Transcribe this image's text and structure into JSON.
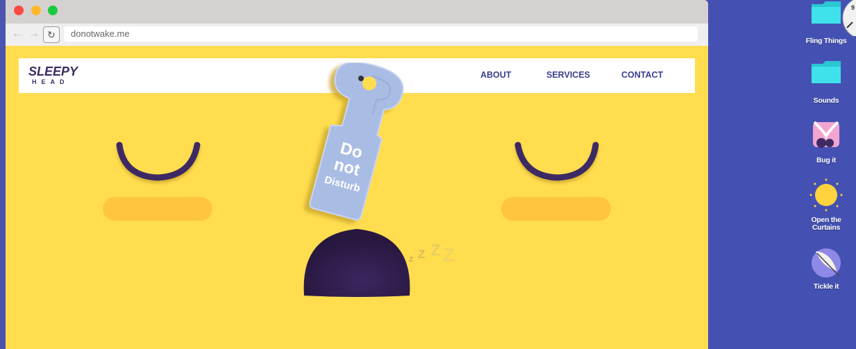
{
  "browser": {
    "url": "donotwake.me",
    "back_icon": "arrow-left-icon",
    "forward_icon": "arrow-right-icon",
    "reload_icon": "reload-icon"
  },
  "site": {
    "logo_top": "SLEEPY",
    "logo_bottom": "HEAD",
    "menu": [
      "ABOUT",
      "SERVICES",
      "CONTACT"
    ],
    "hanger_text": [
      "Do",
      "not",
      "Disturb"
    ],
    "zzz": [
      "z",
      "Z",
      "Z"
    ],
    "colors": {
      "background": "#ffdd4f",
      "cheek": "#ffc53f",
      "eyes": "#3d2a63",
      "mouth": "#2e1b4b",
      "hanger": "#a9bce4",
      "menu": "#3b3f8d"
    }
  },
  "desktop": {
    "background": "#4451b3",
    "items": [
      {
        "label": "Fling Things",
        "icon": "folder-icon"
      },
      {
        "label": "Sounds",
        "icon": "folder-icon"
      },
      {
        "label": "Bug it",
        "icon": "bug-icon"
      },
      {
        "label": "Open the Curtains",
        "icon": "sun-icon"
      },
      {
        "label": "Tickle it",
        "icon": "feather-icon"
      }
    ]
  }
}
